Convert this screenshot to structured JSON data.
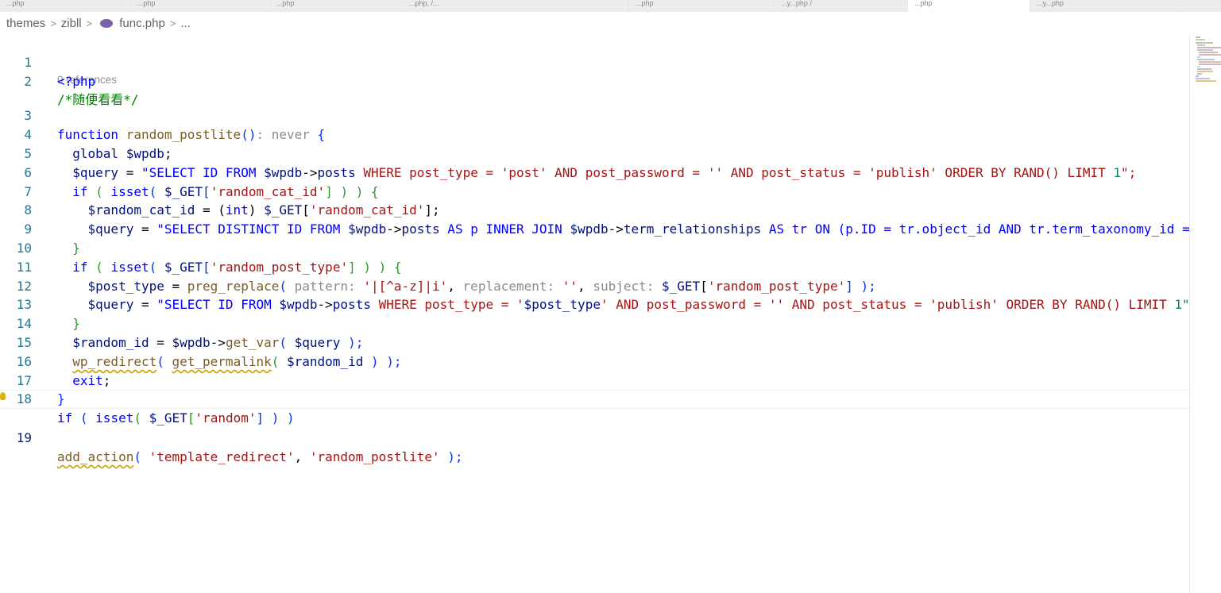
{
  "tabs": [
    "...php",
    "...php",
    "...php",
    "...php, /...",
    "...php",
    "...y...php /",
    "...php",
    "...y...php"
  ],
  "breadcrumb": {
    "items": [
      "themes",
      "zibll",
      "func.php",
      "..."
    ],
    "separator": ">",
    "file_icon": "php-elephant-icon"
  },
  "editor": {
    "codelens": "0 references",
    "line_numbers": [
      "1",
      "2",
      "3",
      "4",
      "5",
      "6",
      "7",
      "8",
      "9",
      "10",
      "11",
      "12",
      "13",
      "14",
      "15",
      "16",
      "17",
      "18",
      "19"
    ],
    "lines": {
      "l1": [
        "<?php"
      ],
      "l2": [
        "/*随便看看*/"
      ],
      "l3": [
        "function",
        " random_postlite",
        "()",
        ": never",
        " {"
      ],
      "l4": [
        "  global ",
        "$wpdb",
        ";"
      ],
      "l5": [
        "  ",
        "$query",
        " = ",
        "\"SELECT ID FROM ",
        "$wpdb",
        "->",
        "posts",
        " WHERE post_type = 'post' AND post_password = '' AND post_status = 'publish' ORDER BY RAND() LIMIT ",
        "1",
        "\";"
      ],
      "l6": [
        "  ",
        "if",
        " ( ",
        "isset",
        "( ",
        "$_GET",
        "[",
        "'random_cat_id'",
        "] ) ) {"
      ],
      "l7": [
        "    ",
        "$random_cat_id",
        " = (",
        "int",
        ") ",
        "$_GET",
        "[",
        "'random_cat_id'",
        "];"
      ],
      "l8": [
        "    ",
        "$query",
        " = ",
        "\"SELECT DISTINCT ID FROM ",
        "$wpdb",
        "->",
        "posts",
        " AS p INNER JOIN ",
        "$wpdb",
        "->",
        "term_relationships",
        " AS tr ON (p.ID = tr.object_id AND tr.term_taxonomy_id ="
      ],
      "l9": [
        "  }"
      ],
      "l10": [
        "  ",
        "if",
        " ( ",
        "isset",
        "( ",
        "$_GET",
        "[",
        "'random_post_type'",
        "] ) ) {"
      ],
      "l11": [
        "    ",
        "$post_type",
        " = ",
        "preg_replace",
        "( ",
        "pattern:",
        " '|[^a-z]|i'",
        ", ",
        "replacement:",
        " ''",
        ", ",
        "subject:",
        " ",
        "$_GET",
        "[",
        "'random_post_type'",
        "] );"
      ],
      "l12": [
        "    ",
        "$query",
        " = ",
        "\"SELECT ID FROM ",
        "$wpdb",
        "->",
        "posts",
        " WHERE post_type = '",
        "$post_type",
        "' AND post_password = '' AND post_status = 'publish' ORDER BY RAND() LIMIT ",
        "1\""
      ],
      "l13": [
        "  }"
      ],
      "l14": [
        "  ",
        "$random_id",
        " = ",
        "$wpdb",
        "->",
        "get_var",
        "( ",
        "$query",
        " );"
      ],
      "l15": [
        "  ",
        "wp_redirect",
        "( ",
        "get_permalink",
        "( ",
        "$random_id",
        " ) );"
      ],
      "l16": [
        "  ",
        "exit",
        ";"
      ],
      "l17": [
        "}"
      ],
      "l18": [
        "if",
        " ( ",
        "isset",
        "( ",
        "$_GET",
        "[",
        "'random'",
        "] ) )"
      ],
      "l19": [
        "add_action",
        "( ",
        "'template_redirect'",
        ", ",
        "'random_postlite'",
        " );"
      ]
    },
    "current_line": "19",
    "lightbulb_icon": "lightbulb-icon"
  },
  "colors": {
    "keyword": "#0000ff",
    "string": "#a31515",
    "variable": "#001080",
    "function": "#795e26",
    "comment": "#008000",
    "number": "#098658",
    "line_number": "#237893",
    "hint": "#8c8c8c"
  }
}
